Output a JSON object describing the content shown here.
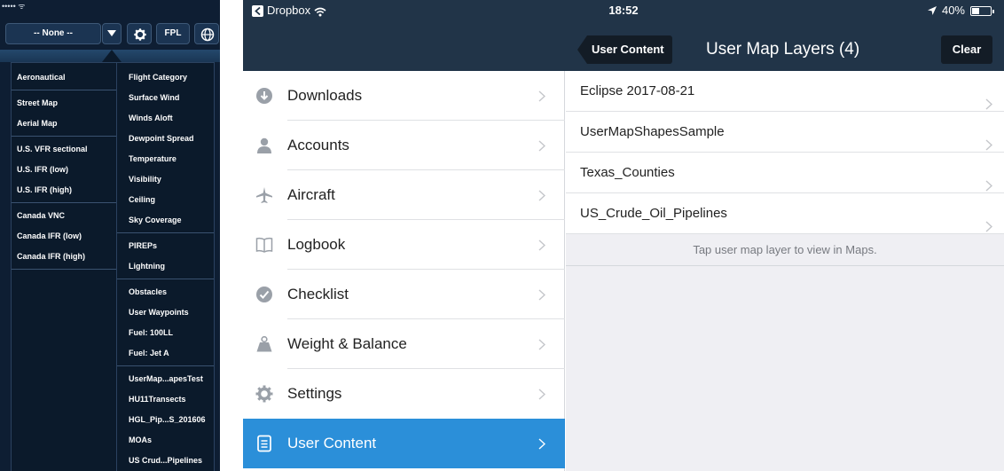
{
  "map_panel": {
    "status": "••••• ᯤ",
    "layer_select": "-- None --",
    "fpl_label": "FPL",
    "base_layers": [
      [
        "Aeronautical"
      ],
      [
        "Street Map",
        "Aerial Map"
      ],
      [
        "U.S. VFR sectional",
        "U.S. IFR (low)",
        "U.S. IFR (high)"
      ],
      [
        "Canada VNC",
        "Canada IFR (low)",
        "Canada IFR (high)"
      ]
    ],
    "overlay_layers": [
      [
        "Flight Category",
        "Surface Wind",
        "Winds Aloft",
        "Dewpoint Spread",
        "Temperature",
        "Visibility",
        "Ceiling",
        "Sky Coverage"
      ],
      [
        "PIREPs",
        "Lightning"
      ],
      [
        "Obstacles",
        "User Waypoints",
        "Fuel: 100LL",
        "Fuel: Jet A"
      ],
      [
        "UserMap...apesTest",
        "HU11Transects",
        "HGL_Pip...S_201606",
        "MOAs",
        "US Crud...Pipelines"
      ]
    ]
  },
  "status_bar": {
    "back_app": "Dropbox",
    "time": "18:52",
    "battery": "40%",
    "battery_level": 0.4
  },
  "nav": {
    "back_label": "User Content",
    "title": "User Map Layers (4)",
    "clear_label": "Clear"
  },
  "master": {
    "items": [
      {
        "label": "Downloads",
        "icon": "download-icon"
      },
      {
        "label": "Accounts",
        "icon": "person-icon"
      },
      {
        "label": "Aircraft",
        "icon": "airplane-icon"
      },
      {
        "label": "Logbook",
        "icon": "book-icon"
      },
      {
        "label": "Checklist",
        "icon": "checkmark-icon"
      },
      {
        "label": "Weight & Balance",
        "icon": "scale-icon"
      },
      {
        "label": "Settings",
        "icon": "gear-icon"
      },
      {
        "label": "User Content",
        "icon": "document-icon",
        "selected": true
      }
    ]
  },
  "detail": {
    "layers": [
      "Eclipse 2017-08-21",
      "UserMapShapesSample",
      "Texas_Counties",
      "US_Crude_Oil_Pipelines"
    ],
    "footer": "Tap user map layer to view in Maps."
  },
  "colors": {
    "nav_background": "#213448",
    "selection_blue": "#2b8fd9",
    "map_menu_background": "#0b1a2b"
  }
}
